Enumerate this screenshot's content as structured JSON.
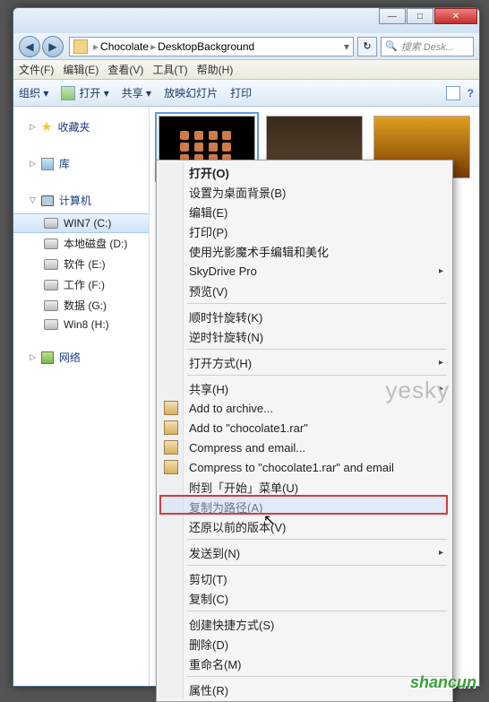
{
  "window": {
    "minimize": "—",
    "maximize": "□",
    "close": "✕"
  },
  "nav": {
    "back": "◀",
    "forward": "▶",
    "path1": "Chocolate",
    "path2": "DesktopBackground",
    "refresh": "↻",
    "search_placeholder": "搜索 Desk..."
  },
  "menubar": {
    "file": "文件(F)",
    "edit": "编辑(E)",
    "view": "查看(V)",
    "tools": "工具(T)",
    "help": "帮助(H)"
  },
  "cmdbar": {
    "organize": "组织 ▾",
    "open": "打开 ▾",
    "share": "共享 ▾",
    "slideshow": "放映幻灯片",
    "print": "打印",
    "help": "?"
  },
  "sidebar": {
    "favorites": "收藏夹",
    "libraries": "库",
    "computer": "计算机",
    "drives": [
      "WIN7 (C:)",
      "本地磁盘 (D:)",
      "软件 (E:)",
      "工作 (F:)",
      "数据 (G:)",
      "Win8 (H:)"
    ],
    "network": "网络"
  },
  "context": {
    "open": "打开(O)",
    "setbg": "设置为桌面背景(B)",
    "edit": "编辑(E)",
    "print": "打印(P)",
    "neoim": "使用光影魔术手编辑和美化",
    "skydrive": "SkyDrive Pro",
    "preview": "预览(V)",
    "rotcw": "顺时针旋转(K)",
    "rotccw": "逆时针旋转(N)",
    "openwith": "打开方式(H)",
    "sharewith": "共享(H)",
    "addarchive": "Add to archive...",
    "addrar": "Add to \"chocolate1.rar\"",
    "compemail": "Compress and email...",
    "comprar": "Compress to \"chocolate1.rar\" and email",
    "pinstart": "附到「开始」菜单(U)",
    "copypath": "复制为路径(A)",
    "restore": "还原以前的版本(V)",
    "sendto": "发送到(N)",
    "cut": "剪切(T)",
    "copy": "复制(C)",
    "shortcut": "创建快捷方式(S)",
    "delete": "删除(D)",
    "rename": "重命名(M)",
    "properties": "属性(R)"
  },
  "watermarks": {
    "yesky": "yesky",
    "shancun": "shancun"
  }
}
